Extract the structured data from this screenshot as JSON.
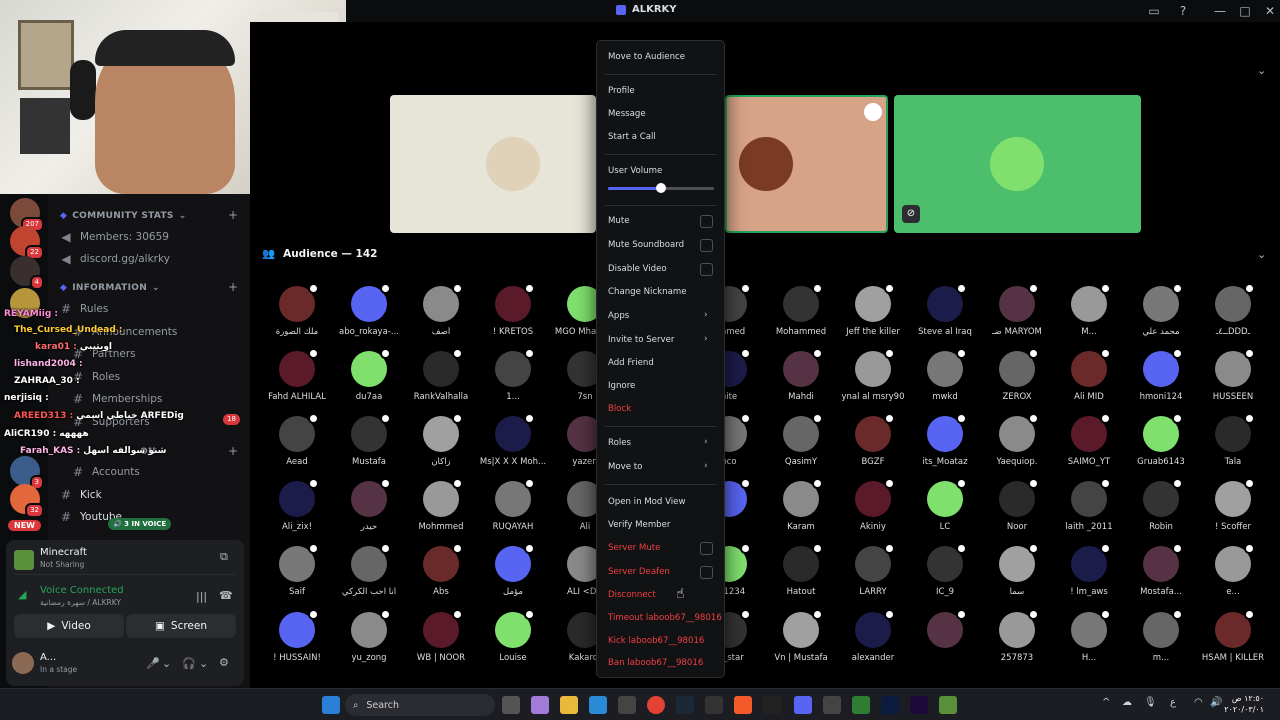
{
  "window": {
    "title": "ALKRKY"
  },
  "sidebar": {
    "server_badges": [
      "207",
      "22",
      "4",
      "3",
      "32"
    ],
    "new_badge": "NEW",
    "categories": {
      "community": "COMMUNITY STATS",
      "information": "INFORMATION",
      "other": "ON"
    },
    "channels": {
      "members": "Members: 30659",
      "invite": "discord.gg/alkrky",
      "rules": "Rules",
      "announcements": "Announcements",
      "partners": "Partners",
      "roles": "Roles",
      "memberships": "Memberships",
      "supporters": "Supporters",
      "accounts": "Accounts",
      "kick": "Kick",
      "youtube": "Youtube"
    },
    "supporters_badge": "18",
    "in_voice": "3 IN VOICE"
  },
  "chat_overlay": [
    {
      "name": "REYAMiig :",
      "msg": ""
    },
    {
      "name": "The_Cursed_Undead :",
      "msg": ""
    },
    {
      "name": "kara01 :",
      "msg": "اويتيبي"
    },
    {
      "name": "lishand2004 :",
      "msg": ""
    },
    {
      "name": "ZAHRAA_30 :",
      "msg": ""
    },
    {
      "name": "nerjisiq :",
      "msg": ""
    },
    {
      "name": "AREED313 :",
      "msg": "خياطي اسمي ARFEDig"
    },
    {
      "name": "AliCR190 :",
      "msg": "ههههه"
    },
    {
      "name": "Farah_KAS :",
      "msg": "شنو سوالفه اسهل"
    }
  ],
  "user_panel": {
    "game_title": "Minecraft",
    "game_status": "Not Sharing",
    "voice_status": "Voice Connected",
    "voice_location": "سهرة رمضانية / ALKRKY",
    "video_label": "Video",
    "screen_label": "Screen",
    "username": "A...",
    "user_status": "In a stage"
  },
  "audience": {
    "title": "Audience — 142",
    "members": [
      [
        "ملك الصورة",
        "abo_rokaya-...",
        "أصف",
        "! KRETOS",
        "MGO Mhamed",
        "",
        "ammed",
        "Mohammed",
        "Jeff the killer",
        "Steve al Iraq",
        "ضـ MARYOM",
        "M...",
        "محمد علي",
        "ــ٤ـDDDـ"
      ],
      [
        "Fahd ALHILAL",
        "du7aa",
        "RankValhalla",
        "1...",
        "7sn",
        "",
        "hite",
        "Mahdi",
        "ynal al msry90",
        "mwkd",
        "ZEROX",
        "Ali MID",
        "hmoni124",
        "HUSSEEN"
      ],
      [
        "Aead",
        "Mustafa",
        "زاكان",
        "Ms|X X X Moh...",
        "yazen",
        "",
        "oco",
        "QasimY",
        "BGZF",
        "its_Moataz",
        "Yaequiop.",
        "SAIMO_YT",
        "Gruab6143",
        "Tala"
      ],
      [
        "Ali_zix!",
        "حيدر",
        "Mohmmed",
        "RUQAYAH",
        "Ali",
        "",
        "",
        "Karam",
        "Akiniy",
        "LC",
        "Noor",
        "laith _2011",
        "Robin",
        "! Scoffer"
      ],
      [
        "Saif",
        "انا احب الكركي",
        "Abs",
        "مؤمل",
        "ALI <DD",
        "",
        "na1234",
        "Hatout",
        "LARRY",
        "IC_9",
        "سما",
        "! lm_aws",
        "Mostafa...",
        "e..."
      ],
      [
        "! HUSSAIN!",
        "yu_zong",
        "WB | NOOR",
        "Louise",
        "Kakarot",
        "",
        "er_star",
        "Vn | Mustafa",
        "alexander",
        "",
        "257873",
        "H...",
        "m...",
        "HSAM | KILLER"
      ]
    ]
  },
  "context_menu": {
    "move_to_audience": "Move to Audience",
    "profile": "Profile",
    "message": "Message",
    "start_call": "Start a Call",
    "user_volume": "User Volume",
    "user_volume_level": 0.5,
    "mute": "Mute",
    "mute_soundboard": "Mute Soundboard",
    "disable_video": "Disable Video",
    "change_nickname": "Change Nickname",
    "apps": "Apps",
    "invite_to_server": "Invite to Server",
    "add_friend": "Add Friend",
    "ignore": "Ignore",
    "block": "Block",
    "roles": "Roles",
    "move_to": "Move to",
    "open_mod_view": "Open in Mod View",
    "verify_member": "Verify Member",
    "server_mute": "Server Mute",
    "server_deafen": "Server Deafen",
    "disconnect": "Disconnect",
    "timeout": "Timeout laboob67__98016",
    "kick": "Kick laboob67__98016",
    "ban": "Ban laboob67__98016"
  },
  "taskbar": {
    "search_placeholder": "Search",
    "time": "١٢:٥٠ ص",
    "date": "٢٠٢٠/٠٣/٠١",
    "lang": "ع"
  },
  "colors": {
    "blurple": "#5865f2",
    "danger": "#f23f43",
    "voice_green": "#23a55a",
    "tile_green": "#4dbf6c"
  }
}
